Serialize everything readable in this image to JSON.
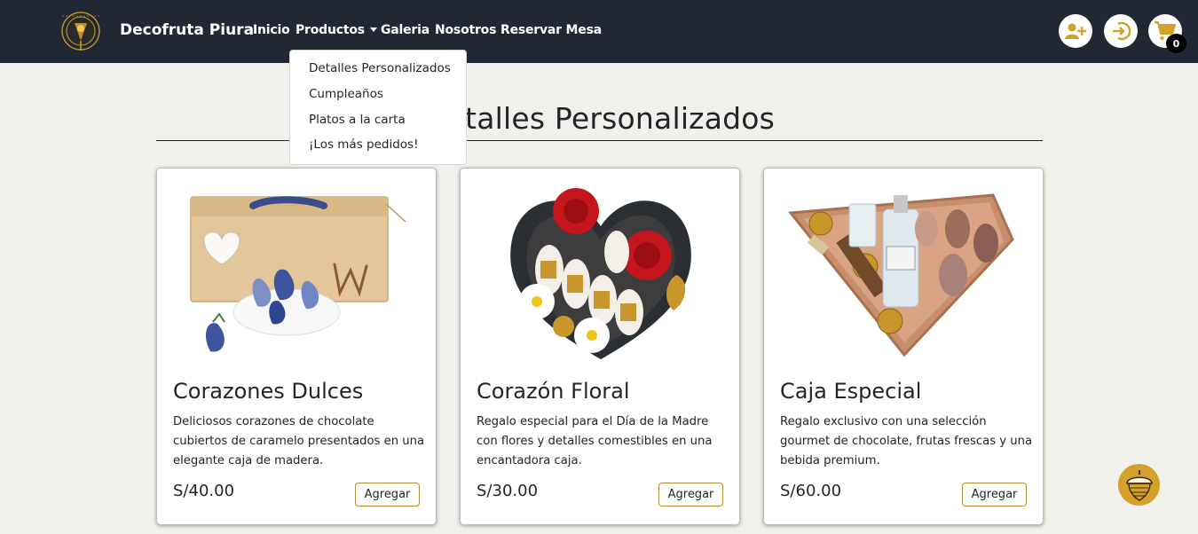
{
  "navbar": {
    "brand": "Decofruta Piura",
    "links": {
      "inicio": "Inicio",
      "productos": "Productos",
      "galeria": "Galeria",
      "nosotros": "Nosotros",
      "reservar": "Reservar Mesa"
    },
    "cart_count": "0"
  },
  "dropdown": {
    "items": [
      "Detalles Personalizados",
      "Cumpleaños",
      "Platos a la carta",
      "¡Los más pedidos!"
    ]
  },
  "page": {
    "title": "Detalles Personalizados"
  },
  "products": [
    {
      "name": "Corazones Dulces",
      "description": "Deliciosos corazones de chocolate cubiertos de caramelo presentados en una elegante caja de madera.",
      "price": "S/40.00",
      "button": "Agregar"
    },
    {
      "name": "Corazón Floral",
      "description": "Regalo especial para el Día de la Madre con flores y detalles comestibles en una encantadora caja.",
      "price": "S/30.00",
      "button": "Agregar"
    },
    {
      "name": "Caja Especial",
      "description": "Regalo exclusivo con una selección gourmet de chocolate, frutas frescas y una bebida premium.",
      "price": "S/60.00",
      "button": "Agregar"
    }
  ],
  "colors": {
    "navbar_bg": "#212733",
    "page_bg": "#f2f0eb",
    "accent_gold": "#d4a12b",
    "button_border": "#b08d2e"
  },
  "icons": {
    "logo": "golden-crest-logo",
    "register": "user-plus-icon",
    "login": "login-arrow-icon",
    "cart": "shopping-cart-icon",
    "floating": "acorn-icon"
  }
}
